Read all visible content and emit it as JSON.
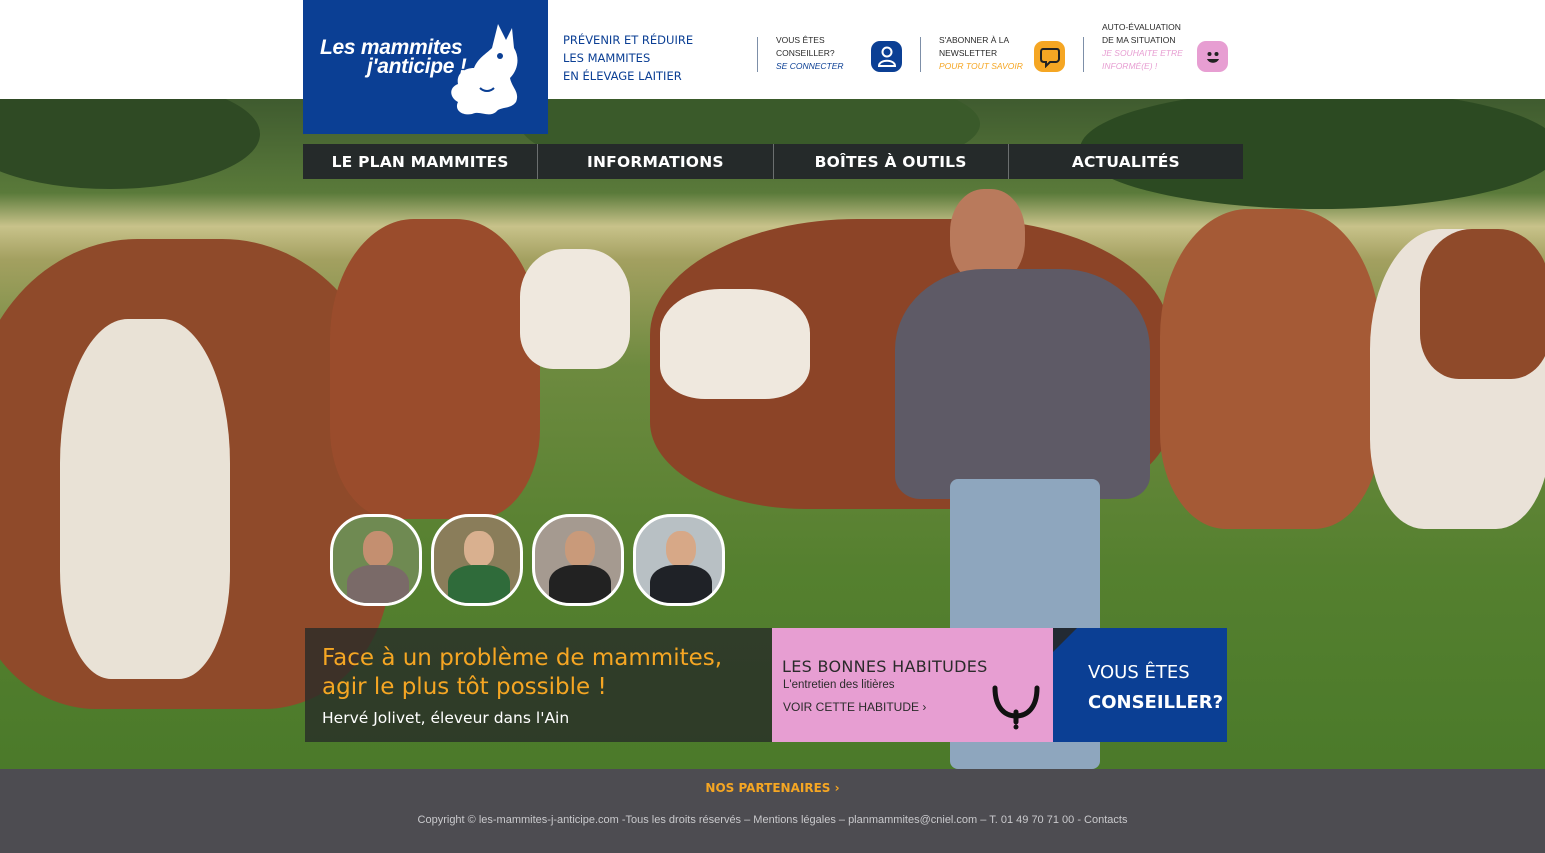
{
  "header": {
    "logo_line1": "Les mammites",
    "logo_line2": "j'anticipe !",
    "tagline": [
      "PRÉVENIR ET RÉDUIRE",
      "LES MAMMITES",
      "EN ÉLEVAGE LAITIER"
    ],
    "advisor": {
      "line1": "VOUS ÊTES",
      "line2": "CONSEILLER?",
      "action": "SE CONNECTER",
      "action_color": "#0b3f94"
    },
    "newsletter": {
      "line1": "S'ABONNER À LA",
      "line2": "NEWSLETTER",
      "action": "POUR TOUT SAVOIR",
      "action_color": "#f5a623"
    },
    "self_eval": {
      "line1": "AUTO-ÉVALUATION",
      "line2": "DE MA SITUATION",
      "action": "JE SOUHAITE ETRE",
      "action2": "INFORMÉ(E) !",
      "action_color": "#e79ed2"
    }
  },
  "nav": {
    "items": [
      "LE PLAN MAMMITES",
      "INFORMATIONS",
      "BOÎTES À OUTILS",
      "ACTUALITÉS"
    ]
  },
  "hero": {
    "quote": "Face à un problème de mammites, agir le plus tôt possible !",
    "author": "Hervé Jolivet, éleveur dans l'Ain"
  },
  "habit": {
    "title": "LES BONNES HABITUDES",
    "subtitle": "L'entretien des litières",
    "link": "VOIR CETTE HABITUDE"
  },
  "advisor_box": {
    "line1": "VOUS ÊTES",
    "line2": "CONSEILLER?"
  },
  "footer": {
    "partners": "NOS PARTENAIRES",
    "copyright": "Copyright © les-mammites-j-anticipe.com -Tous les droits réservés – Mentions légales – planmammites@cniel.com – T. 01 49 70 71 00 - Contacts"
  },
  "colors": {
    "brand_blue": "#0b3f94",
    "accent_orange": "#f5a623",
    "accent_pink": "#e79ed2",
    "nav_bg": "#252a2a",
    "footer_bg": "#4d4c51"
  }
}
